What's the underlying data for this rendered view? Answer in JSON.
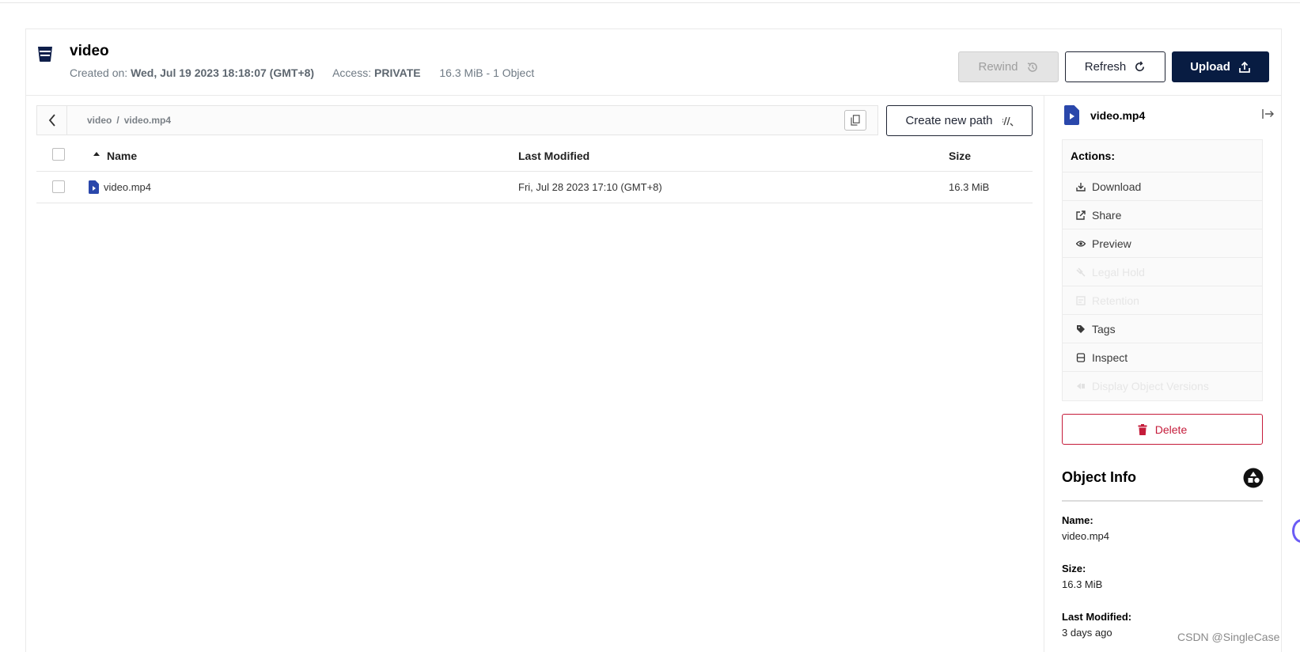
{
  "bucket": {
    "name": "video",
    "created_label": "Created on:",
    "created_value": "Wed, Jul 19 2023 18:18:07 (GMT+8)",
    "access_label": "Access:",
    "access_value": "PRIVATE",
    "summary": "16.3 MiB - 1 Object"
  },
  "toolbar": {
    "rewind_label": "Rewind",
    "refresh_label": "Refresh",
    "upload_label": "Upload"
  },
  "breadcrumb": {
    "parts": [
      "video",
      "video.mp4"
    ],
    "separator": "/"
  },
  "create_path_label": "Create new path",
  "table": {
    "columns": [
      "Name",
      "Last Modified",
      "Size"
    ],
    "rows": [
      {
        "name": "video.mp4",
        "last_modified": "Fri, Jul 28 2023 17:10 (GMT+8)",
        "size": "16.3 MiB"
      }
    ]
  },
  "panel": {
    "title": "video.mp4",
    "actions_header": "Actions:",
    "actions": [
      {
        "label": "Download",
        "icon": "download-icon",
        "enabled": true
      },
      {
        "label": "Share",
        "icon": "share-icon",
        "enabled": true
      },
      {
        "label": "Preview",
        "icon": "eye-icon",
        "enabled": true
      },
      {
        "label": "Legal Hold",
        "icon": "gavel-icon",
        "enabled": false
      },
      {
        "label": "Retention",
        "icon": "retention-icon",
        "enabled": false
      },
      {
        "label": "Tags",
        "icon": "tag-icon",
        "enabled": true
      },
      {
        "label": "Inspect",
        "icon": "inspect-icon",
        "enabled": true
      },
      {
        "label": "Display Object Versions",
        "icon": "versions-icon",
        "enabled": false
      }
    ],
    "delete_label": "Delete",
    "object_info_title": "Object Info",
    "info": {
      "name_label": "Name:",
      "name_value": "video.mp4",
      "size_label": "Size:",
      "size_value": "16.3 MiB",
      "modified_label": "Last Modified:",
      "modified_value": "3 days ago"
    }
  },
  "watermark": "CSDN @SingleCase",
  "colors": {
    "primary": "#081c42",
    "danger": "#c51b3a",
    "file_icon": "#2a47ab"
  }
}
